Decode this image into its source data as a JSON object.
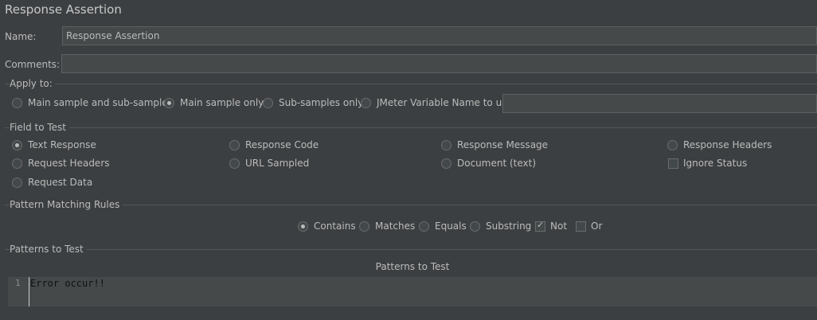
{
  "title": "Response Assertion",
  "name": {
    "label": "Name:",
    "value": "Response Assertion"
  },
  "comments": {
    "label": "Comments:",
    "value": ""
  },
  "apply_to": {
    "title": "Apply to:",
    "options": [
      {
        "label": "Main sample and sub-samples",
        "selected": false
      },
      {
        "label": "Main sample only",
        "selected": true
      },
      {
        "label": "Sub-samples only",
        "selected": false
      },
      {
        "label": "JMeter Variable Name to use",
        "selected": false
      }
    ],
    "variable_value": ""
  },
  "field_to_test": {
    "title": "Field to Test",
    "options": [
      {
        "label": "Text Response",
        "selected": true
      },
      {
        "label": "Response Code",
        "selected": false
      },
      {
        "label": "Response Message",
        "selected": false
      },
      {
        "label": "Response Headers",
        "selected": false
      },
      {
        "label": "Request Headers",
        "selected": false
      },
      {
        "label": "URL Sampled",
        "selected": false
      },
      {
        "label": "Document (text)",
        "selected": false
      },
      {
        "label": "Request Data",
        "selected": false
      }
    ],
    "ignore_status": {
      "label": "Ignore Status",
      "checked": false
    }
  },
  "pattern_matching": {
    "title": "Pattern Matching Rules",
    "options": [
      {
        "label": "Contains",
        "selected": true
      },
      {
        "label": "Matches",
        "selected": false
      },
      {
        "label": "Equals",
        "selected": false
      },
      {
        "label": "Substring",
        "selected": false
      }
    ],
    "not": {
      "label": "Not",
      "checked": true
    },
    "or": {
      "label": "Or",
      "checked": false
    }
  },
  "patterns": {
    "title": "Patterns to Test",
    "column_header": "Patterns to Test",
    "rows": [
      {
        "line": "1",
        "text": "Error occur!!"
      }
    ]
  }
}
